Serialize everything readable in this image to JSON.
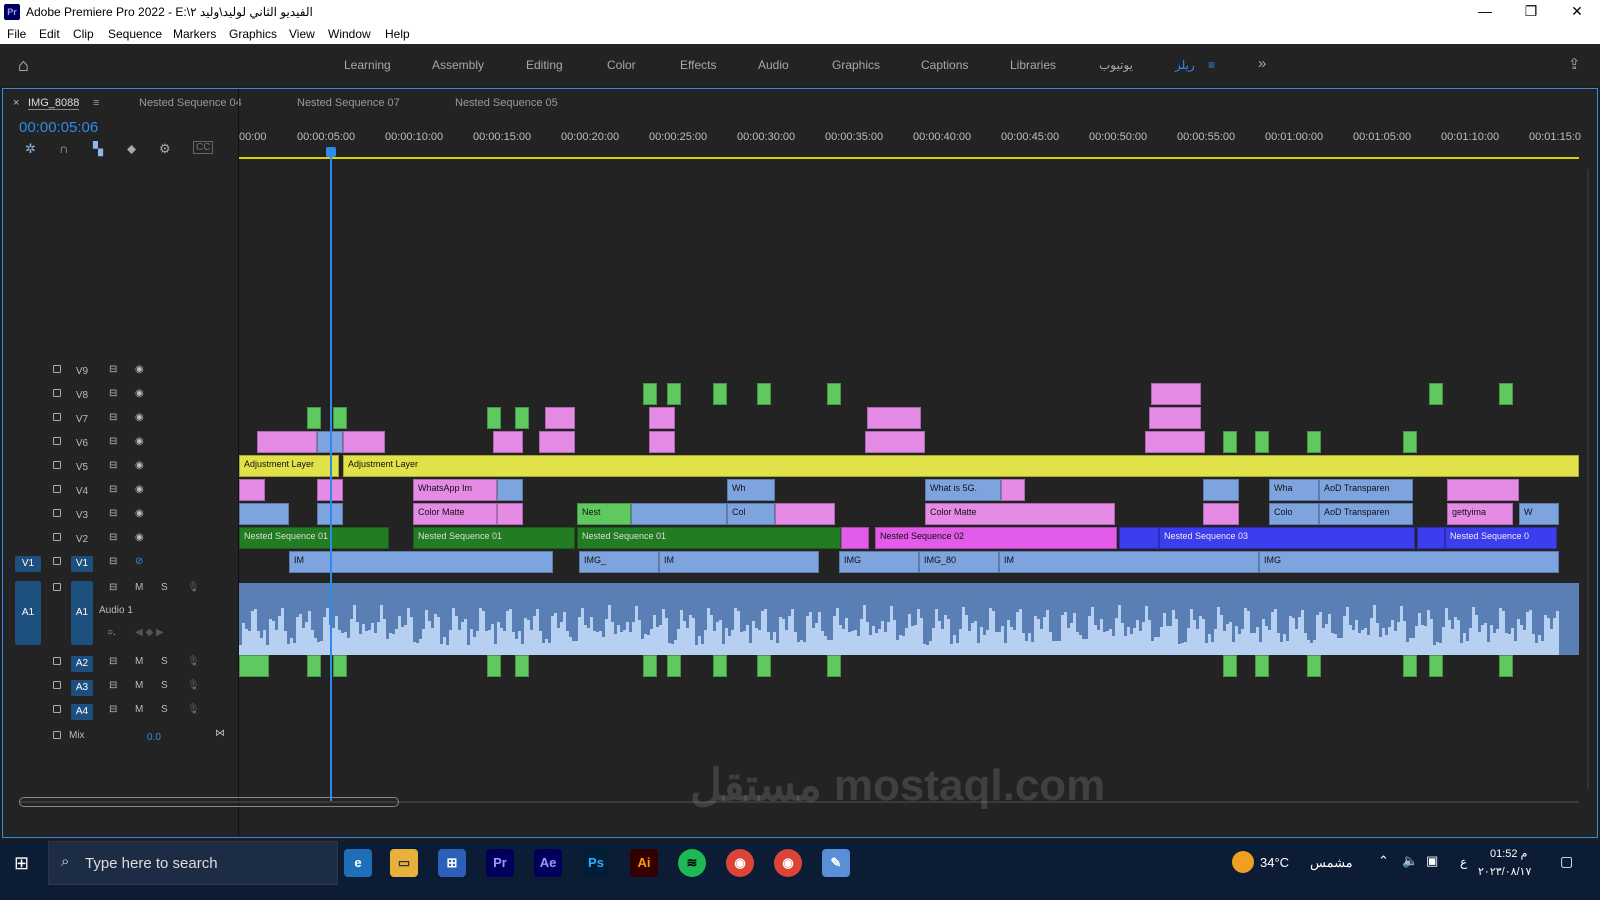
{
  "window": {
    "title": "Adobe Premiere Pro 2022 - E:\\الفيديو الثاني لوليد\\وليد ٢",
    "minimize": "—",
    "maximize": "❐",
    "close": "✕",
    "logo": "Pr"
  },
  "menu": [
    "File",
    "Edit",
    "Clip",
    "Sequence",
    "Markers",
    "Graphics",
    "View",
    "Window",
    "Help"
  ],
  "workspaces": {
    "items": [
      "Learning",
      "Assembly",
      "Editing",
      "Color",
      "Effects",
      "Audio",
      "Graphics",
      "Captions",
      "Libraries",
      "يوتيوب",
      "ريلز"
    ],
    "active": "ريلز",
    "more": "»"
  },
  "tabs": [
    "IMG_8088",
    "Nested Sequence 04",
    "Nested Sequence 07",
    "Nested Sequence 05"
  ],
  "timecode": "00:00:05:06",
  "ruler": [
    "00:00",
    "00:00:05:00",
    "00:00:10:00",
    "00:00:15:00",
    "00:00:20:00",
    "00:00:25:00",
    "00:00:30:00",
    "00:00:35:00",
    "00:00:40:00",
    "00:00:45:00",
    "00:00:50:00",
    "00:00:55:00",
    "00:01:00:00",
    "00:01:05:00",
    "00:01:10:00",
    "00:01:15:0"
  ],
  "tracks": {
    "video": [
      "V9",
      "V8",
      "V7",
      "V6",
      "V5",
      "V4",
      "V3",
      "V2",
      "V1"
    ],
    "src_v": "V1",
    "audio": [
      "A1",
      "A2",
      "A3",
      "A4"
    ],
    "src_a": "A1",
    "audio1_label": "Audio 1",
    "mix_label": "Mix",
    "mix_value": "0.0",
    "m": "M",
    "s": "S"
  },
  "clips": {
    "adj1": "Adjustment Layer",
    "adj2": "Adjustment Layer",
    "whatsapp": "WhatsApp Im",
    "wh": "Wh",
    "whatis": "What is 5G.",
    "wha": "Wha",
    "aod1": "AoD Transparen",
    "aod2": "AoD Transparen",
    "colormatte1": "Color Matte",
    "colormatte2": "Color Matte",
    "nest": "Nest",
    "col": "Col",
    "colo": "Colo",
    "getty": "gettyima",
    "w": "W",
    "ns1a": "Nested Sequence 01",
    "ns1b": "Nested Sequence 01",
    "ns1c": "Nested Sequence 01",
    "ns2": "Nested Sequence 02",
    "ns3": "Nested Sequence 03",
    "ns0": "Nested Sequence 0",
    "img1": "IM",
    "img2": "IMG_",
    "img3": "IM",
    "img4": "IMG",
    "img5": "IMG_80",
    "img6": "IM",
    "img7": "IMG"
  },
  "taskbar": {
    "search_placeholder": "Type here to search",
    "weather": "34°C",
    "weather_label": "مشمس",
    "time": "01:52 م",
    "date": "٢٠٢٣/٠٨/١٧",
    "lang": "ع"
  },
  "watermark": "مستقل mostaql.com"
}
